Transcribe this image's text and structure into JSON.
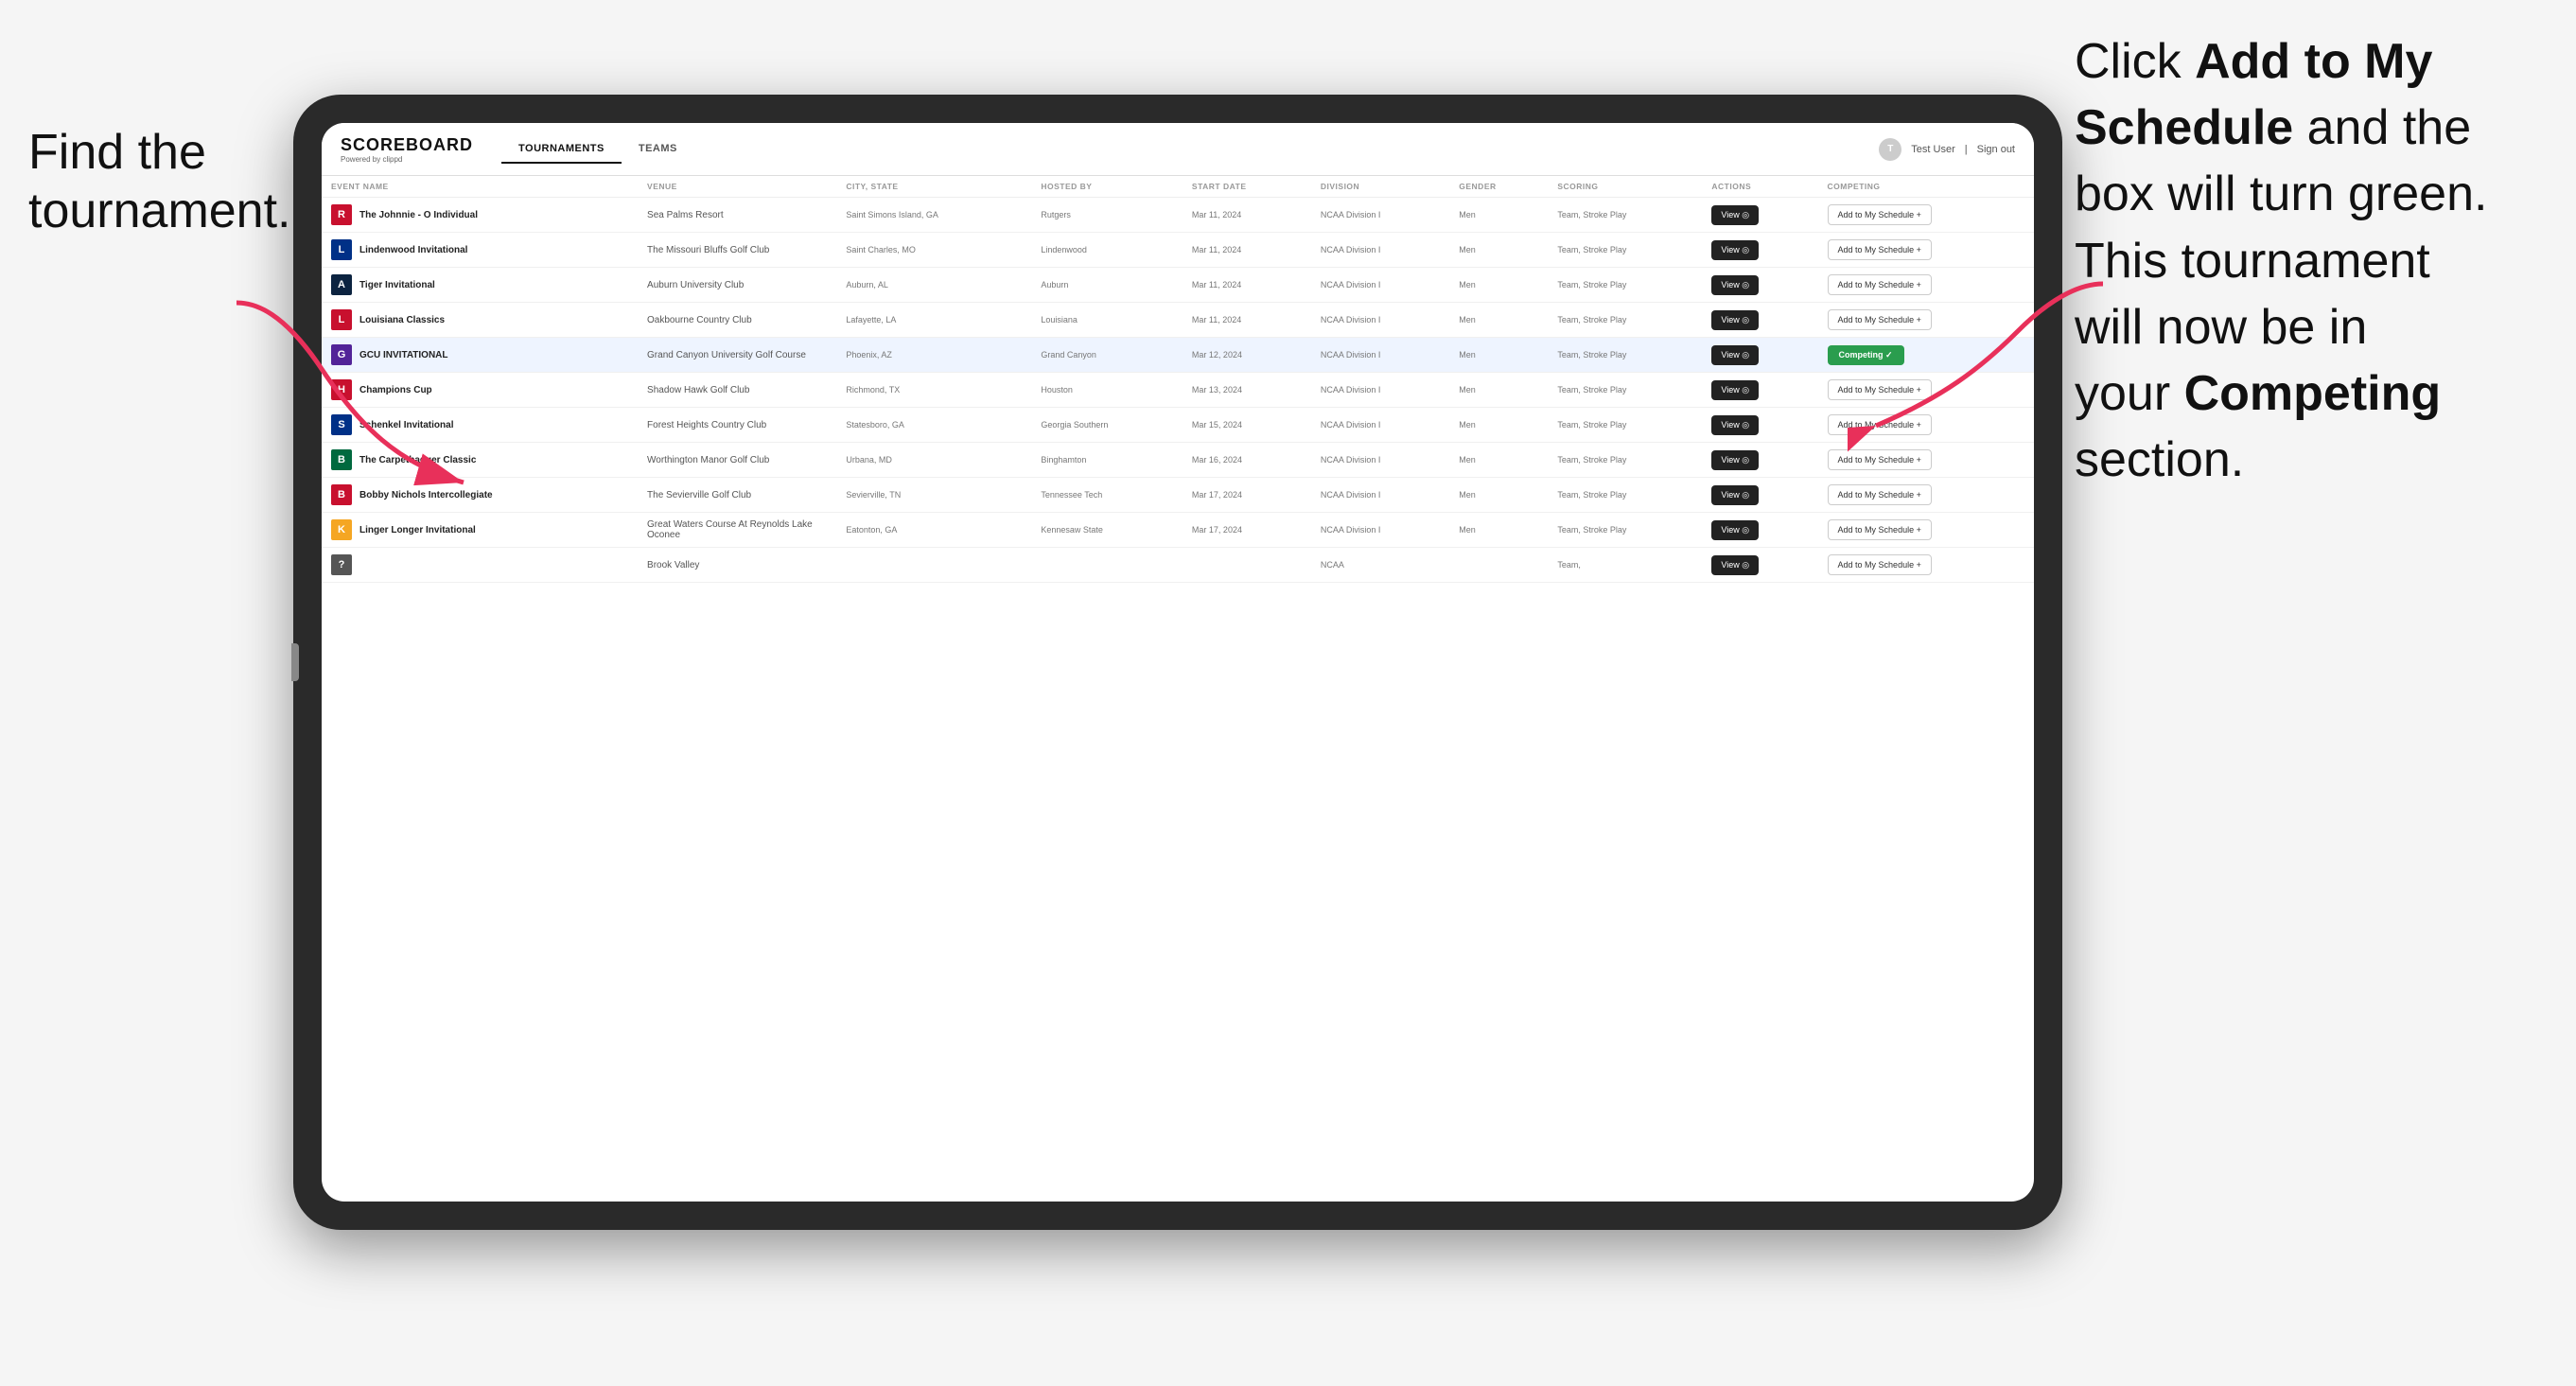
{
  "annotations": {
    "left": "Find the\ntournament.",
    "right_part1": "Click ",
    "right_bold1": "Add to My\nSchedule",
    "right_part2": " and the\nbox will turn green.\nThis tournament\nwill now be in\nyour ",
    "right_bold2": "Competing",
    "right_part3": "\nsection."
  },
  "header": {
    "logo": "SCOREBOARD",
    "logo_sub": "Powered by clippd",
    "nav": [
      "TOURNAMENTS",
      "TEAMS"
    ],
    "active_nav": "TOURNAMENTS",
    "user": "Test User",
    "signout": "Sign out"
  },
  "table": {
    "columns": [
      "EVENT NAME",
      "VENUE",
      "CITY, STATE",
      "HOSTED BY",
      "START DATE",
      "DIVISION",
      "GENDER",
      "SCORING",
      "ACTIONS",
      "COMPETING"
    ],
    "rows": [
      {
        "logo_color": "#c8102e",
        "logo_letter": "R",
        "name": "The Johnnie - O Individual",
        "venue": "Sea Palms Resort",
        "city_state": "Saint Simons Island, GA",
        "hosted_by": "Rutgers",
        "start_date": "Mar 11, 2024",
        "division": "NCAA Division I",
        "gender": "Men",
        "scoring": "Team, Stroke Play",
        "status": "add"
      },
      {
        "logo_color": "#003087",
        "logo_letter": "L",
        "name": "Lindenwood Invitational",
        "venue": "The Missouri Bluffs Golf Club",
        "city_state": "Saint Charles, MO",
        "hosted_by": "Lindenwood",
        "start_date": "Mar 11, 2024",
        "division": "NCAA Division I",
        "gender": "Men",
        "scoring": "Team, Stroke Play",
        "status": "add"
      },
      {
        "logo_color": "#0c2340",
        "logo_letter": "A",
        "name": "Tiger Invitational",
        "venue": "Auburn University Club",
        "city_state": "Auburn, AL",
        "hosted_by": "Auburn",
        "start_date": "Mar 11, 2024",
        "division": "NCAA Division I",
        "gender": "Men",
        "scoring": "Team, Stroke Play",
        "status": "add"
      },
      {
        "logo_color": "#c8102e",
        "logo_letter": "L",
        "name": "Louisiana Classics",
        "venue": "Oakbourne Country Club",
        "city_state": "Lafayette, LA",
        "hosted_by": "Louisiana",
        "start_date": "Mar 11, 2024",
        "division": "NCAA Division I",
        "gender": "Men",
        "scoring": "Team, Stroke Play",
        "status": "add"
      },
      {
        "logo_color": "#522398",
        "logo_letter": "G",
        "name": "GCU INVITATIONAL",
        "venue": "Grand Canyon University Golf Course",
        "city_state": "Phoenix, AZ",
        "hosted_by": "Grand Canyon",
        "start_date": "Mar 12, 2024",
        "division": "NCAA Division I",
        "gender": "Men",
        "scoring": "Team, Stroke Play",
        "status": "competing",
        "highlighted": true
      },
      {
        "logo_color": "#c8102e",
        "logo_letter": "H",
        "name": "Champions Cup",
        "venue": "Shadow Hawk Golf Club",
        "city_state": "Richmond, TX",
        "hosted_by": "Houston",
        "start_date": "Mar 13, 2024",
        "division": "NCAA Division I",
        "gender": "Men",
        "scoring": "Team, Stroke Play",
        "status": "add"
      },
      {
        "logo_color": "#003087",
        "logo_letter": "S",
        "name": "Schenkel Invitational",
        "venue": "Forest Heights Country Club",
        "city_state": "Statesboro, GA",
        "hosted_by": "Georgia Southern",
        "start_date": "Mar 15, 2024",
        "division": "NCAA Division I",
        "gender": "Men",
        "scoring": "Team, Stroke Play",
        "status": "add"
      },
      {
        "logo_color": "#00693e",
        "logo_letter": "B",
        "name": "The Carpetbagger Classic",
        "venue": "Worthington Manor Golf Club",
        "city_state": "Urbana, MD",
        "hosted_by": "Binghamton",
        "start_date": "Mar 16, 2024",
        "division": "NCAA Division I",
        "gender": "Men",
        "scoring": "Team, Stroke Play",
        "status": "add"
      },
      {
        "logo_color": "#c8102e",
        "logo_letter": "B",
        "name": "Bobby Nichols Intercollegiate",
        "venue": "The Sevierville Golf Club",
        "city_state": "Sevierville, TN",
        "hosted_by": "Tennessee Tech",
        "start_date": "Mar 17, 2024",
        "division": "NCAA Division I",
        "gender": "Men",
        "scoring": "Team, Stroke Play",
        "status": "add"
      },
      {
        "logo_color": "#f5a623",
        "logo_letter": "K",
        "name": "Linger Longer Invitational",
        "venue": "Great Waters Course At Reynolds Lake Oconee",
        "city_state": "Eatonton, GA",
        "hosted_by": "Kennesaw State",
        "start_date": "Mar 17, 2024",
        "division": "NCAA Division I",
        "gender": "Men",
        "scoring": "Team, Stroke Play",
        "status": "add"
      },
      {
        "logo_color": "#555",
        "logo_letter": "?",
        "name": "",
        "venue": "Brook Valley",
        "city_state": "",
        "hosted_by": "",
        "start_date": "",
        "division": "NCAA",
        "gender": "",
        "scoring": "Team,",
        "status": "partial"
      }
    ],
    "add_label": "Add to My Schedule +",
    "competing_label": "Competing ✓",
    "view_label": "View ◎"
  }
}
